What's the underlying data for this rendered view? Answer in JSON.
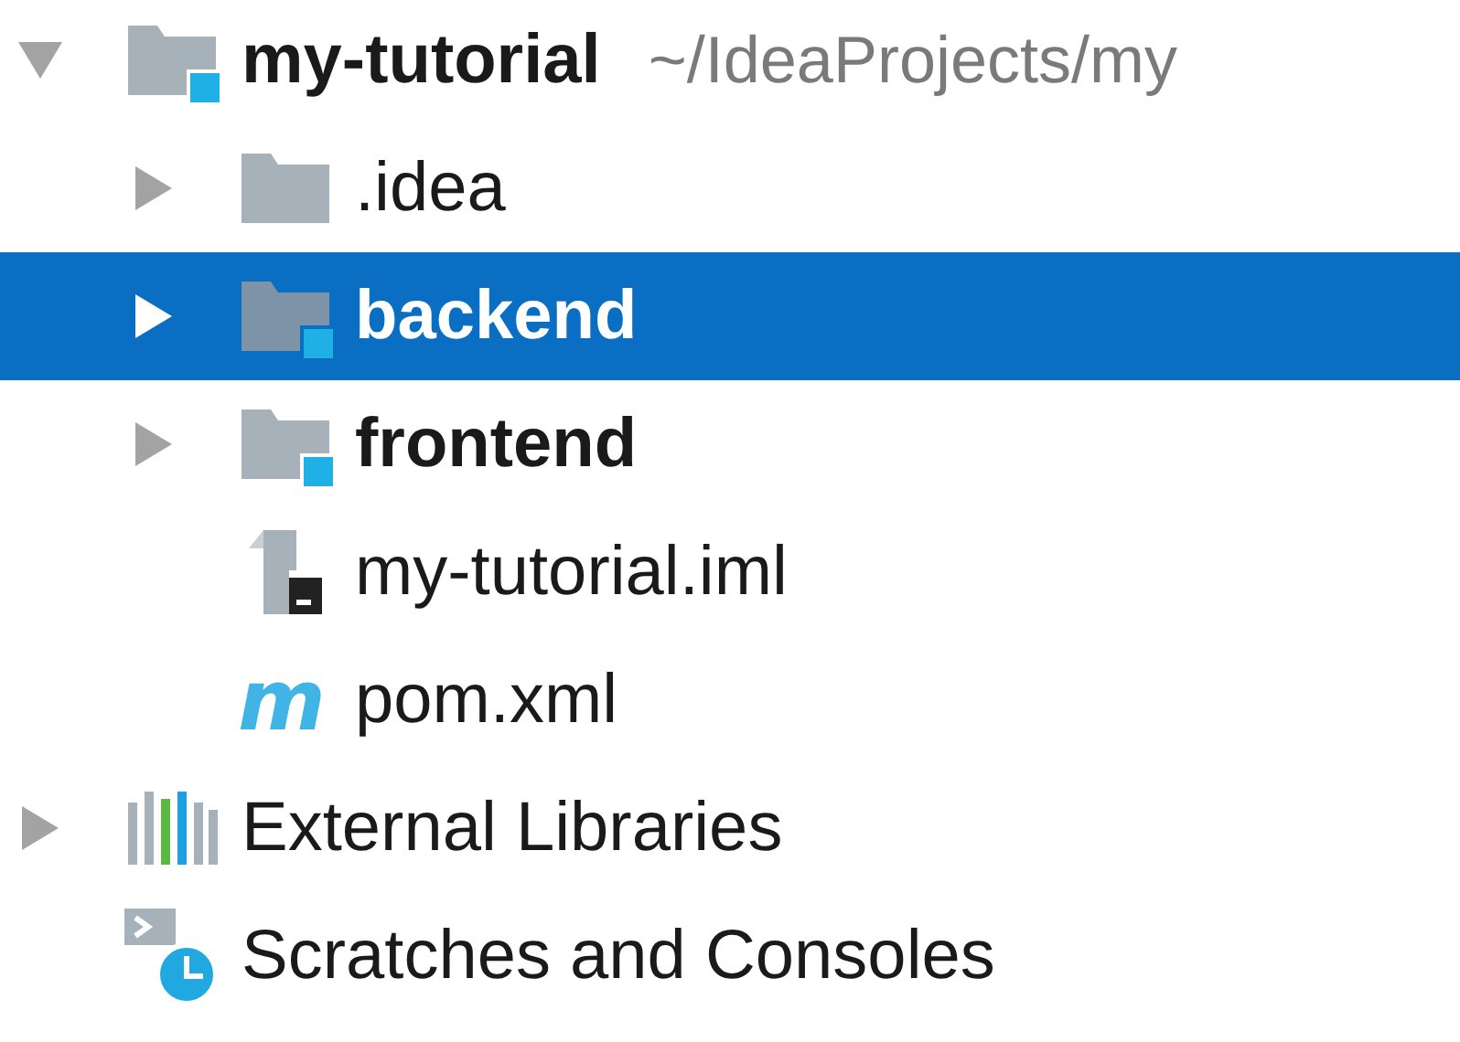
{
  "project_tree": [
    {
      "kind": "project",
      "label": "my-tutorial",
      "location": "~/IdeaProjects/my",
      "expanded": true,
      "selected": false,
      "children": [
        {
          "kind": "folder",
          "label": ".idea",
          "expanded": false,
          "selected": false
        },
        {
          "kind": "module",
          "label": "backend",
          "expanded": false,
          "selected": true
        },
        {
          "kind": "module",
          "label": "frontend",
          "expanded": false,
          "selected": false
        },
        {
          "kind": "iml",
          "label": "my-tutorial.iml",
          "selected": false
        },
        {
          "kind": "maven",
          "label": "pom.xml",
          "icon_text": "m",
          "selected": false
        }
      ]
    },
    {
      "kind": "libraries",
      "label": "External Libraries",
      "expanded": false,
      "selected": false
    },
    {
      "kind": "scratches",
      "label": "Scratches and Consoles",
      "selected": false
    }
  ]
}
